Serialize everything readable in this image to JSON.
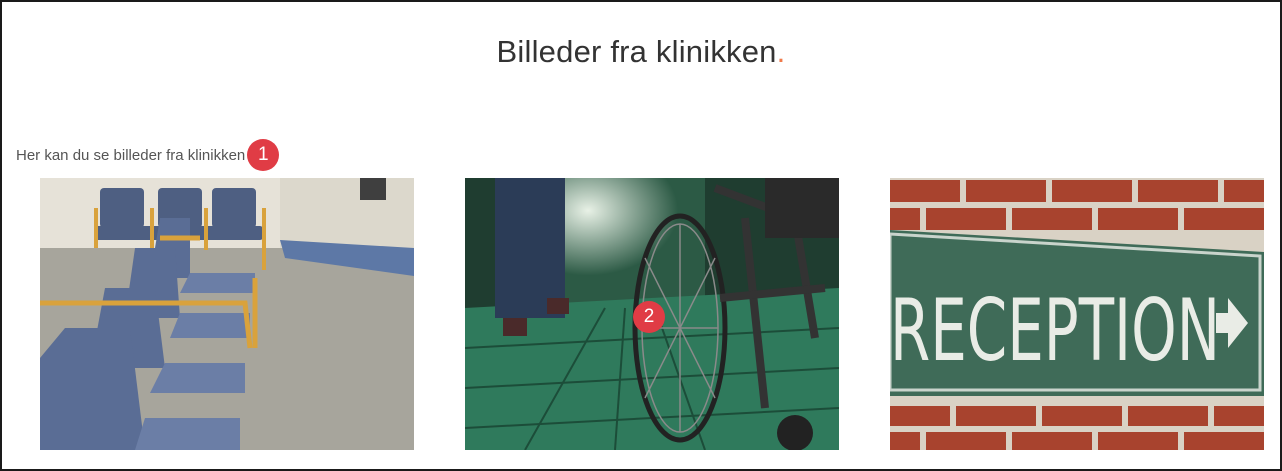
{
  "page": {
    "title": "Billeder fra klinikken",
    "title_dot": ".",
    "intro": "Her kan du se billeder fra klinikken"
  },
  "annotations": [
    {
      "label": "1"
    },
    {
      "label": "2"
    }
  ],
  "gallery": {
    "images": [
      {
        "subject": "waiting-room chairs"
      },
      {
        "subject": "wheelchair in hallway"
      },
      {
        "subject": "reception sign",
        "sign_text": "RECEPTION"
      }
    ]
  },
  "colors": {
    "accent_dot": "#f07a4a",
    "badge": "#e03c45"
  }
}
